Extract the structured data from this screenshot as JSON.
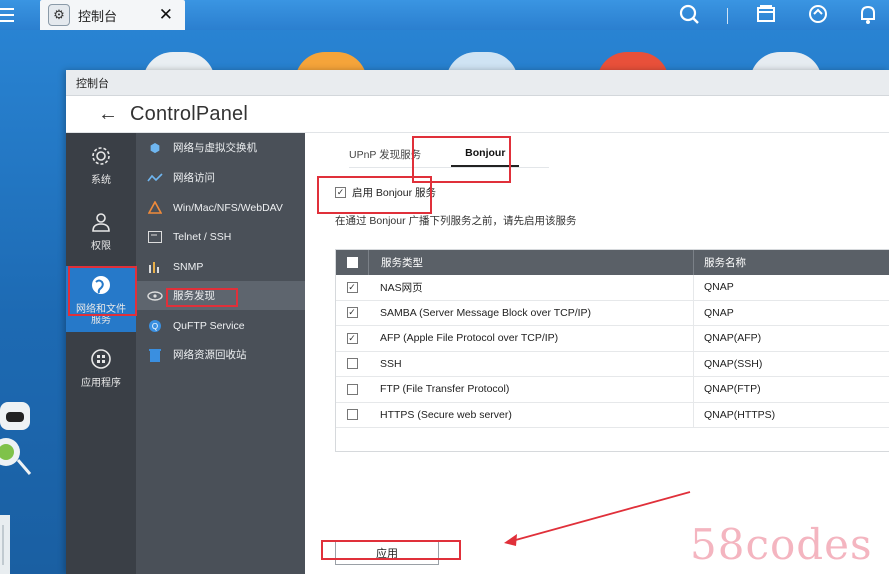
{
  "taskbar": {
    "tab_label": "控制台",
    "tab_icon": "gear-icon",
    "close_label": "✕",
    "right_icons": [
      "search-icon",
      "notes-icon",
      "sync-icon",
      "bell-icon"
    ]
  },
  "window": {
    "titlebar": "控制台",
    "header_title": "ControlPanel",
    "back_icon": "arrow-left-icon"
  },
  "nav_main": [
    {
      "label": "系统",
      "icon": "gear-icon"
    },
    {
      "label": "权限",
      "icon": "user-icon"
    },
    {
      "label": "网络和文件",
      "label2": "服务",
      "icon": "globe-icon",
      "active": true
    },
    {
      "label": "应用程序",
      "icon": "grid-icon"
    }
  ],
  "nav_sub": [
    {
      "label": "网络与虚拟交换机",
      "icon": "network-icon"
    },
    {
      "label": "网络访问",
      "icon": "wave-icon"
    },
    {
      "label": "Win/Mac/NFS/WebDAV",
      "icon": "triangle-icon"
    },
    {
      "label": "Telnet / SSH",
      "icon": "terminal-icon"
    },
    {
      "label": "SNMP",
      "icon": "bars-icon"
    },
    {
      "label": "服务发现",
      "icon": "radar-icon",
      "active": true
    },
    {
      "label": "QuFTP Service",
      "icon": "ftp-icon"
    },
    {
      "label": "网络资源回收站",
      "icon": "trash-icon"
    }
  ],
  "tabs": [
    {
      "label": "UPnP 发现服务",
      "active": false
    },
    {
      "label": "Bonjour",
      "active": true
    }
  ],
  "enable": {
    "label": "启用 Bonjour 服务",
    "checked": true
  },
  "hint": "在通过 Bonjour 广播下列服务之前，请先启用该服务",
  "table": {
    "headers": {
      "type": "服务类型",
      "name": "服务名称"
    },
    "rows": [
      {
        "checked": true,
        "type": "NAS网页",
        "name": "QNAP"
      },
      {
        "checked": true,
        "type": "SAMBA (Server Message Block over TCP/IP)",
        "name": "QNAP"
      },
      {
        "checked": true,
        "type": "AFP (Apple File Protocol over TCP/IP)",
        "name": "QNAP(AFP)"
      },
      {
        "checked": false,
        "type": "SSH",
        "name": "QNAP(SSH)"
      },
      {
        "checked": false,
        "type": "FTP (File Transfer Protocol)",
        "name": "QNAP(FTP)"
      },
      {
        "checked": false,
        "type": "HTTPS (Secure web server)",
        "name": "QNAP(HTTPS)"
      }
    ]
  },
  "apply_label": "应用",
  "watermark": "58codes",
  "colors": {
    "accent": "#2679c9",
    "annotation": "#e0303a",
    "nav_dark": "#3a3f46",
    "nav_sub": "#4a5058"
  }
}
